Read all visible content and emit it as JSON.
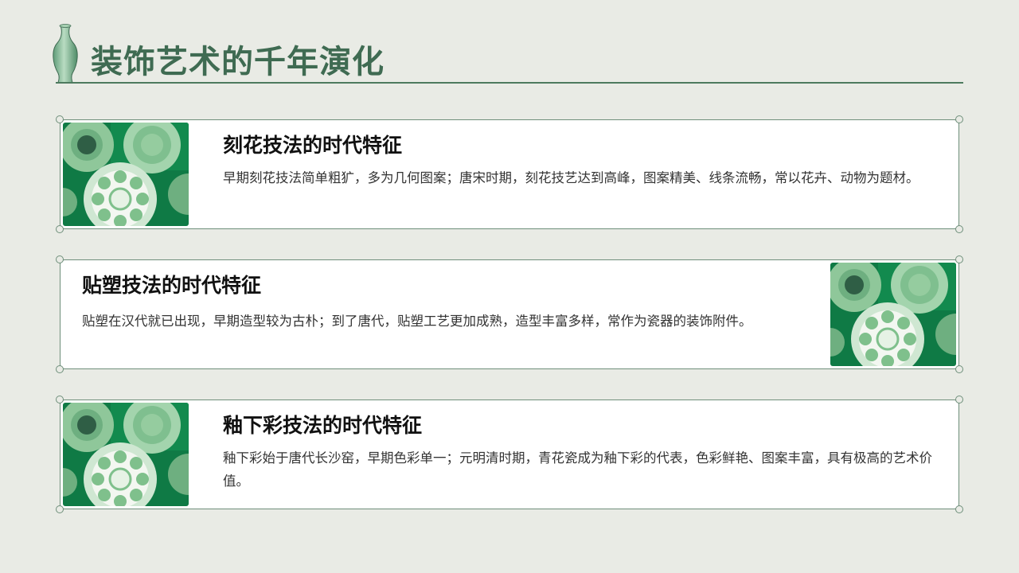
{
  "title": "装饰艺术的千年演化",
  "cards": [
    {
      "heading": "刻花技法的时代特征",
      "body": "早期刻花技法简单粗犷，多为几何图案；唐宋时期，刻花技艺达到高峰，图案精美、线条流畅，常以花卉、动物为题材。"
    },
    {
      "heading": "贴塑技法的时代特征",
      "body": "贴塑在汉代就已出现，早期造型较为古朴；到了唐代，贴塑工艺更加成熟，造型丰富多样，常作为瓷器的装饰附件。"
    },
    {
      "heading": "釉下彩技法的时代特征",
      "body": "釉下彩始于唐代长沙窑，早期色彩单一；元明清时期，青花瓷成为釉下彩的代表，色彩鲜艳、图案丰富，具有极高的艺术价值。"
    }
  ],
  "colors": {
    "background": "#e9ebe5",
    "accent": "#3f6b52",
    "celadon": "#8fc79a",
    "deep_green": "#0f7a45"
  }
}
